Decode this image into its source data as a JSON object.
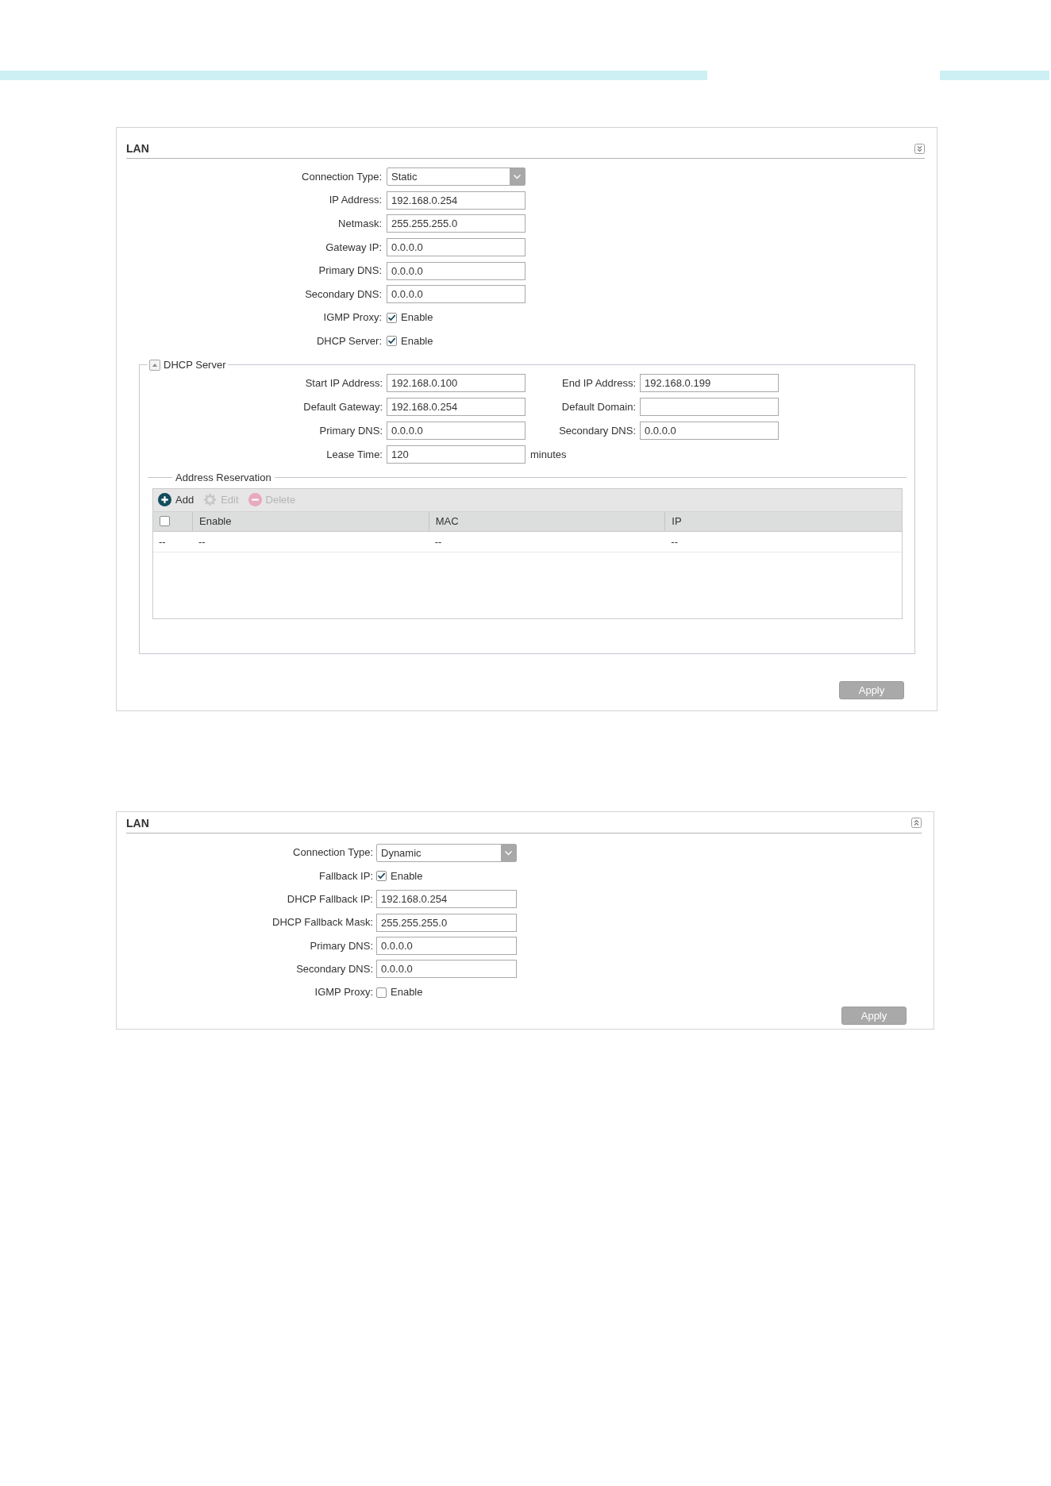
{
  "panels": [
    {
      "title": "LAN",
      "chevrons_up": false,
      "fields": [
        {
          "kind": "select",
          "label": "Connection Type:",
          "value": "Static"
        },
        {
          "kind": "text",
          "label": "IP Address:",
          "value": "192.168.0.254"
        },
        {
          "kind": "text",
          "label": "Netmask:",
          "value": "255.255.255.0"
        },
        {
          "kind": "text",
          "label": "Gateway IP:",
          "value": "0.0.0.0"
        },
        {
          "kind": "text",
          "label": "Primary DNS:",
          "value": "0.0.0.0"
        },
        {
          "kind": "text",
          "label": "Secondary DNS:",
          "value": "0.0.0.0"
        },
        {
          "kind": "checkbox",
          "label": "IGMP Proxy:",
          "option": "Enable",
          "checked": true
        },
        {
          "kind": "checkbox",
          "label": "DHCP Server:",
          "option": "Enable",
          "checked": true
        }
      ],
      "dhcp_server": {
        "title": "DHCP Server",
        "expanded": true,
        "rows": [
          [
            {
              "label": "Start IP Address:",
              "value": "192.168.0.100"
            },
            {
              "label": "End IP Address:",
              "value": "192.168.0.199"
            }
          ],
          [
            {
              "label": "Default Gateway:",
              "value": "192.168.0.254"
            },
            {
              "label": "Default Domain:"
            }
          ],
          [
            {
              "label": "Primary DNS:",
              "value": "0.0.0.0"
            },
            {
              "label": "Secondary DNS:",
              "value": "0.0.0.0"
            }
          ],
          [
            {
              "label": "Lease Time:",
              "value": "120",
              "unit": "minutes"
            }
          ]
        ],
        "address_reservation": {
          "title": "Address Reservation",
          "toolbar": [
            {
              "kind": "add",
              "label": "Add",
              "disabled": false
            },
            {
              "kind": "edit",
              "label": "Edit",
              "disabled": true
            },
            {
              "kind": "delete",
              "label": "Delete",
              "disabled": true
            }
          ],
          "columns": [
            {
              "kind": "checkbox",
              "checked": false
            },
            {
              "kind": "text",
              "label": "Enable"
            },
            {
              "kind": "text",
              "label": "MAC"
            },
            {
              "kind": "text",
              "label": "IP"
            }
          ],
          "rows": [
            [
              "--",
              "--",
              "--",
              "--"
            ]
          ]
        }
      },
      "apply_button": "Apply"
    },
    {
      "title": "LAN",
      "chevrons_up": true,
      "fields": [
        {
          "kind": "select",
          "label": "Connection Type:",
          "value": "Dynamic"
        },
        {
          "kind": "checkbox",
          "label": "Fallback IP:",
          "option": "Enable",
          "checked": true
        },
        {
          "kind": "text",
          "label": "DHCP Fallback IP:",
          "value": "192.168.0.254"
        },
        {
          "kind": "text",
          "label": "DHCP Fallback Mask:",
          "value": "255.255.255.0"
        },
        {
          "kind": "text",
          "label": "Primary DNS:",
          "value": "0.0.0.0"
        },
        {
          "kind": "text",
          "label": "Secondary DNS:",
          "value": "0.0.0.0"
        },
        {
          "kind": "checkbox",
          "label": "IGMP Proxy:",
          "option": "Enable",
          "checked": false
        }
      ],
      "apply_button": "Apply"
    }
  ]
}
